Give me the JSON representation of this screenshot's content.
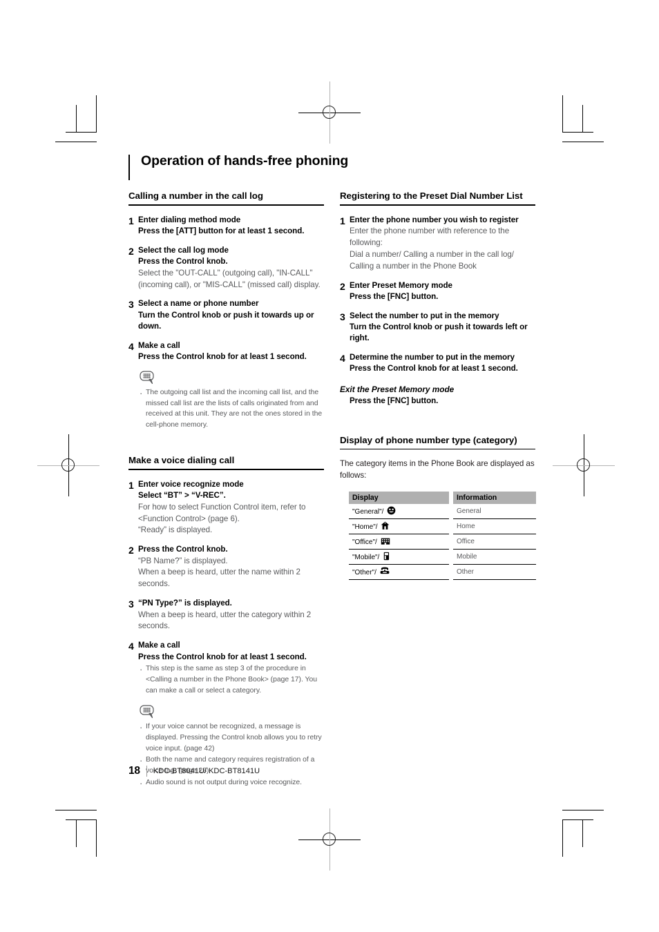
{
  "document": {
    "chapter_title": "Operation of hands-free phoning"
  },
  "left_column": {
    "section1": {
      "heading": "Calling a number in the call log",
      "steps": [
        {
          "num": "1",
          "bold_lines": [
            "Enter dialing method mode",
            "Press the [ATT] button for at least 1 second."
          ],
          "normal_lines": []
        },
        {
          "num": "2",
          "bold_lines": [
            "Select the call log mode",
            "Press the Control knob."
          ],
          "normal_lines": [
            "Select the \"OUT-CALL\" (outgoing call), \"IN-CALL\" (incoming call), or \"MIS-CALL\" (missed call) display."
          ]
        },
        {
          "num": "3",
          "bold_lines": [
            "Select a name or phone number",
            "Turn the Control knob or push it towards up or down."
          ],
          "normal_lines": []
        },
        {
          "num": "4",
          "bold_lines": [
            "Make a call",
            "Press the Control knob for at least 1 second."
          ],
          "normal_lines": []
        }
      ],
      "note_icon": "note-bubble-icon",
      "notes": [
        "The outgoing call list and the incoming call list, and the missed call list are the lists of calls originated from and received at this unit. They are not the ones stored in the cell-phone memory."
      ]
    },
    "section2": {
      "heading": "Make a voice dialing call",
      "steps": [
        {
          "num": "1",
          "bold_lines": [
            "Enter voice recognize mode",
            "Select “BT” > “V-REC”."
          ],
          "normal_lines": [
            "For how to select Function Control item, refer to <Function Control> (page 6).",
            "“Ready” is displayed."
          ]
        },
        {
          "num": "2",
          "bold_lines": [
            "Press the Control knob."
          ],
          "normal_lines": [
            "“PB Name?” is displayed.",
            "When a beep is heard, utter the name within 2 seconds."
          ]
        },
        {
          "num": "3",
          "bold_lines": [
            "“PN Type?” is displayed."
          ],
          "normal_lines": [
            "When a beep is heard, utter the category within 2 seconds."
          ]
        },
        {
          "num": "4",
          "bold_lines": [
            "Make a call",
            "Press the Control knob for at least 1 second."
          ],
          "normal_lines": [],
          "bullets": [
            "This step is the same as step 3 of the procedure in <Calling a number in the Phone Book> (page 17). You can make a call or select a category."
          ]
        }
      ],
      "note_icon": "note-bubble-icon",
      "notes": [
        "If your voice cannot be recognized, a message is displayed. Pressing the Control knob allows you to retry voice input. (page 42)",
        "Both the name and category requires registration of a voice tag. (page 28)",
        "Audio sound is not output during voice recognize."
      ]
    }
  },
  "right_column": {
    "section1": {
      "heading": "Registering to the Preset Dial Number List",
      "steps": [
        {
          "num": "1",
          "bold_lines": [
            "Enter the phone number you wish to register"
          ],
          "normal_lines": [
            "Enter the phone number with reference to the following:",
            "Dial a number/ Calling a number in the call log/ Calling a number in the Phone Book"
          ]
        },
        {
          "num": "2",
          "bold_lines": [
            "Enter Preset Memory mode",
            "Press the [FNC] button."
          ],
          "normal_lines": []
        },
        {
          "num": "3",
          "bold_lines": [
            "Select the number to put in the memory",
            "Turn the Control knob or push it towards left or right."
          ],
          "normal_lines": []
        },
        {
          "num": "4",
          "bold_lines": [
            "Determine the number to put in the memory",
            "Press the Control knob for at least 1 second."
          ],
          "normal_lines": []
        }
      ],
      "exit_heading": "Exit the Preset Memory mode",
      "exit_body": "Press the [FNC] button."
    },
    "section2": {
      "heading": "Display of phone number type (category)",
      "intro": "The category items in the Phone Book are displayed as follows:",
      "table": {
        "columns": [
          "Display",
          "Information"
        ],
        "rows": [
          {
            "display": "\"General\"/",
            "icon": "smiley-face-icon",
            "information": "General"
          },
          {
            "display": "\"Home\"/",
            "icon": "house-icon",
            "information": "Home"
          },
          {
            "display": "\"Office\"/",
            "icon": "office-building-icon",
            "information": "Office"
          },
          {
            "display": "\"Mobile\"/",
            "icon": "mobile-phone-icon",
            "information": "Mobile"
          },
          {
            "display": "\"Other\"/",
            "icon": "telephone-icon",
            "information": "Other"
          }
        ]
      }
    }
  },
  "footer": {
    "page_number": "18",
    "model": "KDC-BT8041U/ KDC-BT8141U"
  },
  "colors": {
    "text": "#000000",
    "body_text": "#58595b",
    "table_header_bg": "#b0b0b0",
    "rule": "#000000"
  }
}
